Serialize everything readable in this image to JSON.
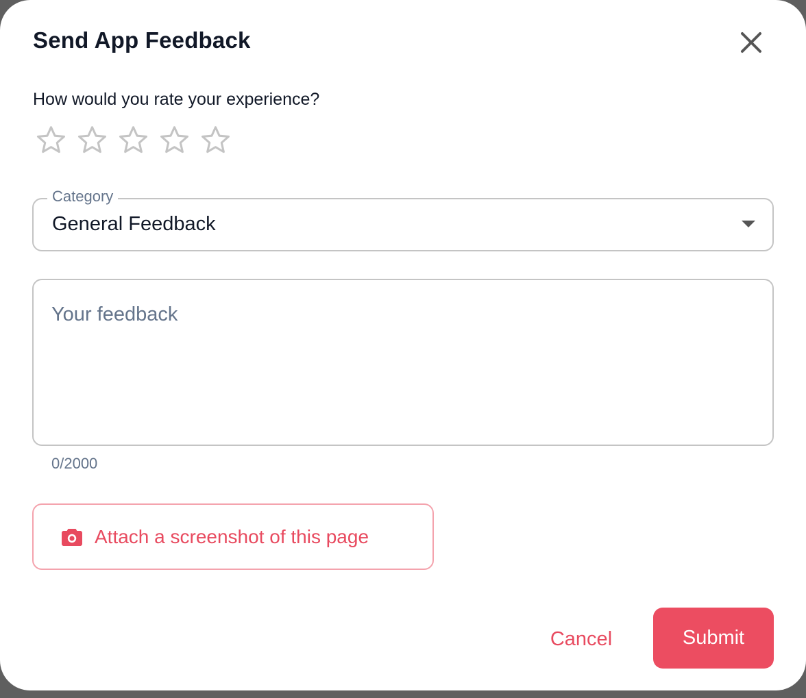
{
  "dialog": {
    "title": "Send App Feedback",
    "close_icon": "close-icon"
  },
  "rating": {
    "label": "How would you rate your experience?",
    "max": 5,
    "value": 0,
    "icon": "star-outline-icon",
    "empty_color": "#c4c4c4"
  },
  "category": {
    "label": "Category",
    "value": "General Feedback",
    "icon": "caret-down-icon"
  },
  "feedback": {
    "value": "",
    "placeholder": "Your feedback",
    "counter": "0/2000"
  },
  "attach": {
    "label": "Attach a screenshot of this page",
    "icon": "camera-icon"
  },
  "actions": {
    "cancel_label": "Cancel",
    "submit_label": "Submit"
  },
  "colors": {
    "accent": "#ec4d61",
    "accent_text": "#e84a5f",
    "accent_border": "#f4a3ad",
    "title_text": "#111827",
    "muted_text": "#64748b",
    "field_border": "#c4c4c4"
  }
}
